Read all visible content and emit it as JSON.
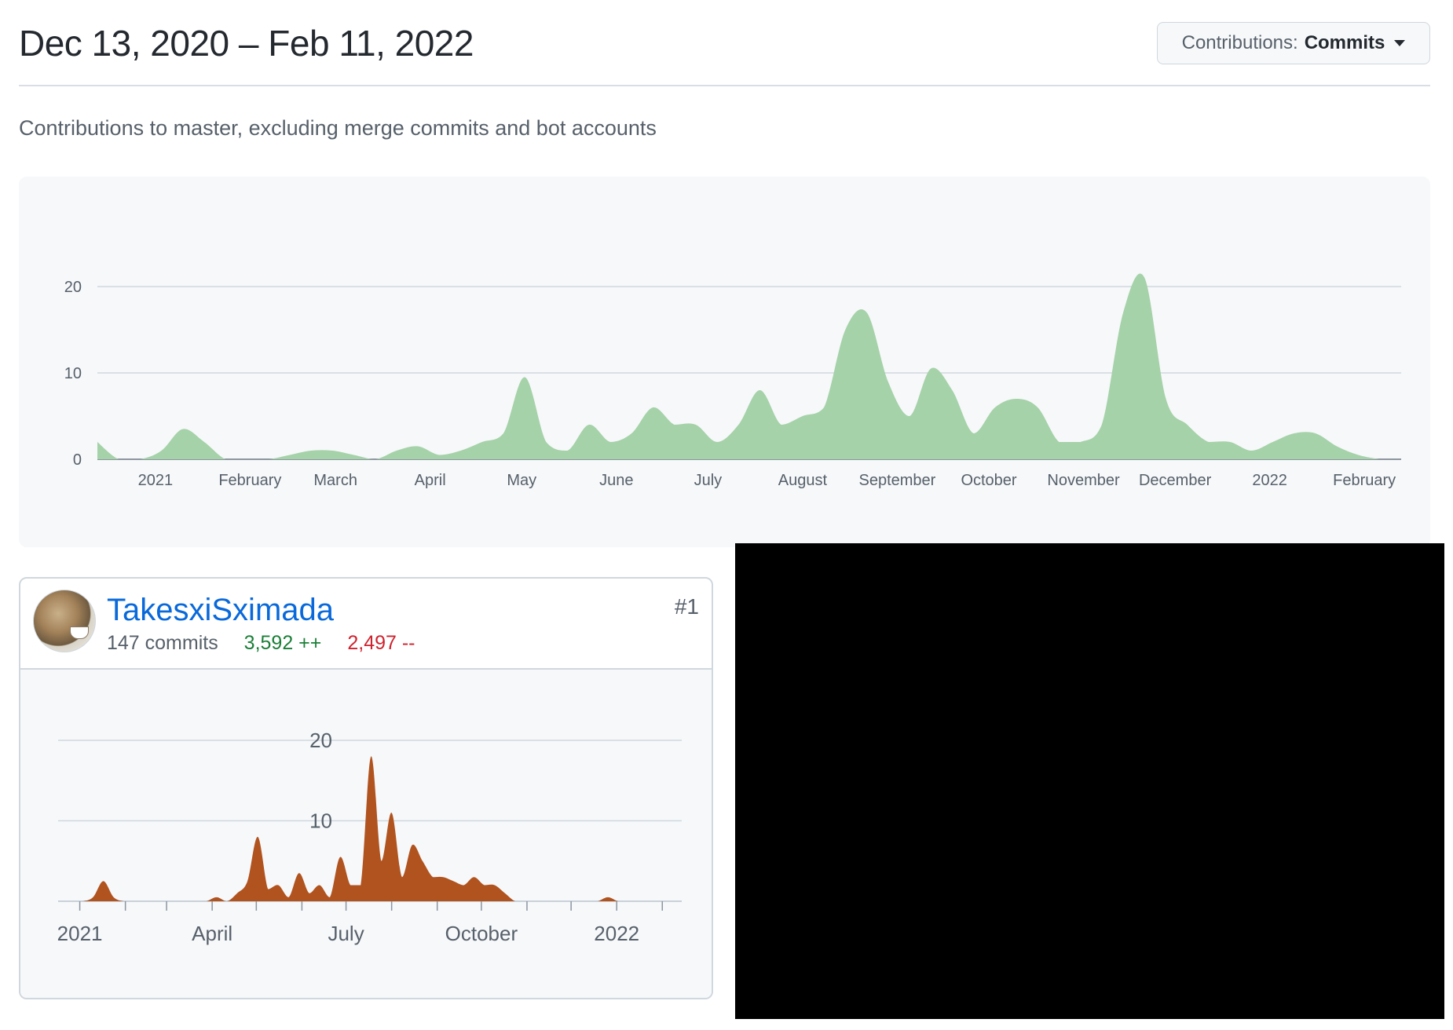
{
  "header": {
    "date_range": "Dec 13, 2020 – Feb 11, 2022",
    "dropdown_label": "Contributions:",
    "dropdown_value": "Commits",
    "subtitle": "Contributions to master, excluding merge commits and bot accounts"
  },
  "colors": {
    "main_area": "#a5d2a8",
    "contributor_area": "#b1531f",
    "link": "#0969da",
    "additions": "#1a7f37",
    "deletions": "#cf222e",
    "redaction": "#000000"
  },
  "contributor": {
    "username": "TakesxiSximada",
    "rank": "#1",
    "commits": "147 commits",
    "additions": "3,592 ++",
    "deletions": "2,497 --",
    "avatar_icon": "avatar-photo-icon"
  },
  "chart_data": [
    {
      "type": "area",
      "ylim": [
        0,
        20
      ],
      "yticks": [
        0,
        10,
        20
      ],
      "ytick_labels": [
        "0",
        "10",
        "20"
      ],
      "xlim": [
        "2020-12-13",
        "2022-02-11"
      ],
      "xtick_labels": [
        "2021",
        "February",
        "March",
        "April",
        "May",
        "June",
        "July",
        "August",
        "September",
        "October",
        "November",
        "December",
        "2022",
        "February"
      ],
      "xtick_dates": [
        "2021-01-01",
        "2021-02-01",
        "2021-03-01",
        "2021-04-01",
        "2021-05-01",
        "2021-06-01",
        "2021-07-01",
        "2021-08-01",
        "2021-09-01",
        "2021-10-01",
        "2021-11-01",
        "2021-12-01",
        "2022-01-01",
        "2022-02-01"
      ],
      "grid": true,
      "x": [
        "2020-12-13",
        "2020-12-20",
        "2020-12-27",
        "2021-01-03",
        "2021-01-10",
        "2021-01-17",
        "2021-01-24",
        "2021-01-31",
        "2021-02-07",
        "2021-02-14",
        "2021-02-21",
        "2021-02-28",
        "2021-03-07",
        "2021-03-14",
        "2021-03-21",
        "2021-03-28",
        "2021-04-04",
        "2021-04-11",
        "2021-04-18",
        "2021-04-25",
        "2021-05-02",
        "2021-05-09",
        "2021-05-16",
        "2021-05-23",
        "2021-05-30",
        "2021-06-06",
        "2021-06-13",
        "2021-06-20",
        "2021-06-27",
        "2021-07-04",
        "2021-07-11",
        "2021-07-18",
        "2021-07-25",
        "2021-08-01",
        "2021-08-08",
        "2021-08-15",
        "2021-08-22",
        "2021-08-29",
        "2021-09-05",
        "2021-09-12",
        "2021-09-19",
        "2021-09-26",
        "2021-10-03",
        "2021-10-10",
        "2021-10-17",
        "2021-10-24",
        "2021-10-31",
        "2021-11-07",
        "2021-11-14",
        "2021-11-21",
        "2021-11-28",
        "2021-12-05",
        "2021-12-12",
        "2021-12-19",
        "2021-12-26",
        "2022-01-02",
        "2022-01-09",
        "2022-01-16",
        "2022-01-23",
        "2022-01-30",
        "2022-02-06"
      ],
      "values": [
        2,
        0,
        0,
        1,
        3.5,
        2,
        0,
        0,
        0,
        0.5,
        1,
        1,
        0.5,
        0,
        1,
        1.5,
        0.5,
        1,
        2,
        3,
        9.5,
        2,
        1,
        4,
        2,
        3,
        6,
        4,
        4,
        2,
        4,
        8,
        4,
        5,
        6,
        15,
        17,
        9,
        5,
        10.5,
        8,
        3,
        6,
        7,
        6,
        2,
        2,
        4,
        17,
        21,
        7,
        4,
        2,
        2,
        1,
        2,
        3,
        3,
        1.5,
        0.5,
        0
      ]
    },
    {
      "type": "area",
      "ylim": [
        0,
        20
      ],
      "yticks": [
        0,
        10,
        20
      ],
      "ytick_labels": [
        "",
        "10",
        "20"
      ],
      "xlim": [
        "2020-12-13",
        "2022-02-11"
      ],
      "xtick_labels": [
        "2021",
        "April",
        "July",
        "October",
        "2022"
      ],
      "xtick_dates": [
        "2021-01-01",
        "2021-04-01",
        "2021-07-01",
        "2021-10-01",
        "2022-01-01"
      ],
      "grid": true,
      "x": [
        "2020-12-13",
        "2020-12-20",
        "2020-12-27",
        "2021-01-03",
        "2021-01-10",
        "2021-01-17",
        "2021-01-24",
        "2021-01-31",
        "2021-02-07",
        "2021-02-14",
        "2021-02-21",
        "2021-02-28",
        "2021-03-07",
        "2021-03-14",
        "2021-03-21",
        "2021-03-28",
        "2021-04-04",
        "2021-04-11",
        "2021-04-18",
        "2021-04-25",
        "2021-05-02",
        "2021-05-09",
        "2021-05-16",
        "2021-05-23",
        "2021-05-30",
        "2021-06-06",
        "2021-06-13",
        "2021-06-20",
        "2021-06-27",
        "2021-07-04",
        "2021-07-11",
        "2021-07-18",
        "2021-07-25",
        "2021-08-01",
        "2021-08-08",
        "2021-08-15",
        "2021-08-22",
        "2021-08-29",
        "2021-09-05",
        "2021-09-12",
        "2021-09-19",
        "2021-09-26",
        "2021-10-03",
        "2021-10-10",
        "2021-10-17",
        "2021-10-24",
        "2021-10-31",
        "2021-11-07",
        "2021-11-14",
        "2021-11-21",
        "2021-11-28",
        "2021-12-05",
        "2021-12-12",
        "2021-12-19",
        "2021-12-26",
        "2022-01-02",
        "2022-01-09",
        "2022-01-16",
        "2022-01-23",
        "2022-01-30",
        "2022-02-06"
      ],
      "values": [
        0,
        0,
        0,
        0,
        0.5,
        2.5,
        0.5,
        0,
        0,
        0,
        0,
        0,
        0,
        0,
        0,
        0,
        0.5,
        0,
        1,
        2.5,
        8,
        1.5,
        2,
        0.5,
        3.5,
        1,
        2,
        0.5,
        5.5,
        2,
        2,
        18,
        5,
        11,
        3,
        7,
        5,
        3,
        3,
        2.5,
        2,
        3,
        2,
        2,
        1,
        0,
        0,
        0,
        0,
        0,
        0,
        0,
        0,
        0,
        0.5,
        0,
        0,
        0,
        0,
        0,
        0
      ]
    }
  ]
}
